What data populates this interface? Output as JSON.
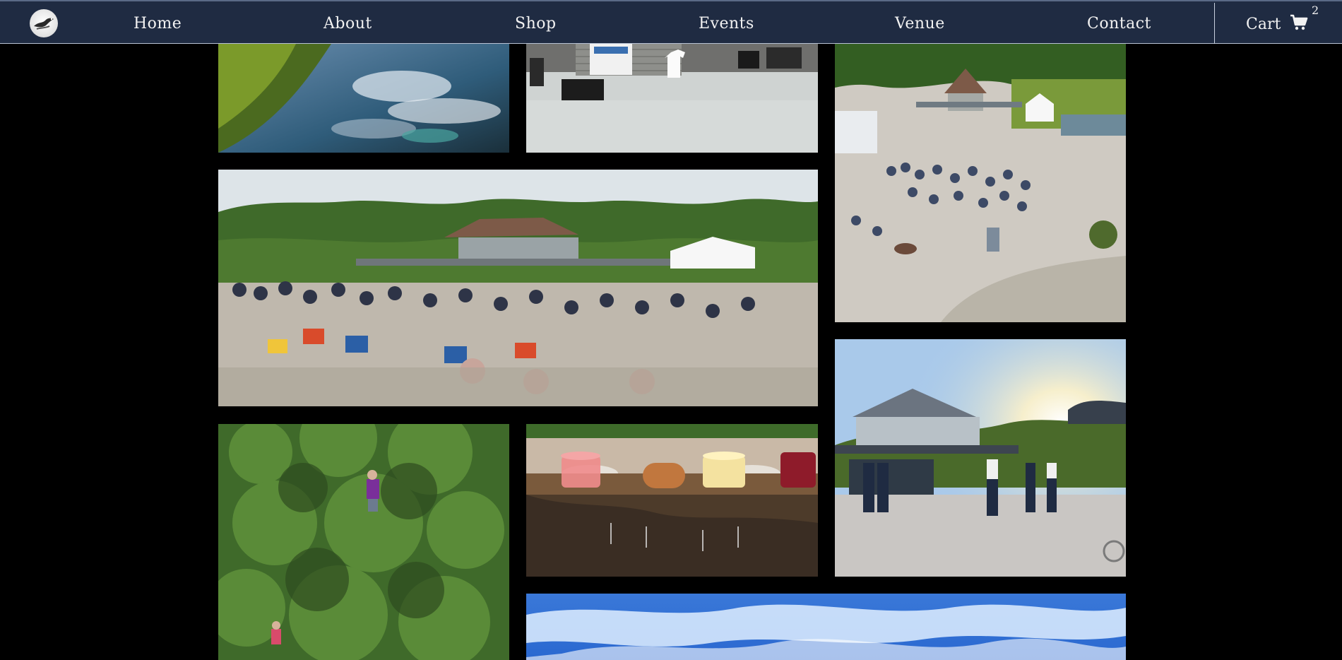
{
  "nav": {
    "items": [
      {
        "label": "Home"
      },
      {
        "label": "About"
      },
      {
        "label": "Shop"
      },
      {
        "label": "Events"
      },
      {
        "label": "Venue"
      },
      {
        "label": "Contact"
      }
    ],
    "cart_label": "Cart",
    "cart_count": "2",
    "logo_icon": "bird-logo-icon",
    "cart_icon": "shopping-cart-icon"
  },
  "colors": {
    "nav_background": "#1f2b42",
    "page_background": "#000000",
    "nav_text": "#f2f2f2"
  },
  "gallery": {
    "photos": [
      {
        "subject": "pond reflection"
      },
      {
        "subject": "stage with t-shirt"
      },
      {
        "subject": "crowd at silo pavilion"
      },
      {
        "subject": "concert audience"
      },
      {
        "subject": "aerial greenery"
      },
      {
        "subject": "drinks on stone ledge"
      },
      {
        "subject": "dancing at sunset"
      },
      {
        "subject": "blue sky"
      }
    ]
  }
}
